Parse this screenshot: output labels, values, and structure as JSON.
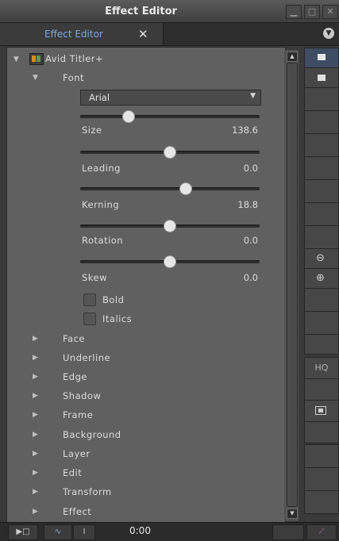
{
  "window": {
    "title": "Effect Editor"
  },
  "tab": {
    "label": "Effect Editor",
    "close": "✕",
    "menu_icon": "chevron-down-icon"
  },
  "tree": {
    "root": {
      "label": "Avid Titler+",
      "icon": "titler-icon"
    },
    "font": {
      "label": "Font",
      "family": "Arial",
      "params": [
        {
          "label": "Size",
          "value": "138.6",
          "slider": 0.27
        },
        {
          "label": "Leading",
          "value": "0.0",
          "slider": 0.5
        },
        {
          "label": "Kerning",
          "value": "18.8",
          "slider": 0.59
        },
        {
          "label": "Rotation",
          "value": "0.0",
          "slider": 0.5
        },
        {
          "label": "Skew",
          "value": "0.0",
          "slider": 0.5
        }
      ],
      "bold": "Bold",
      "italics": "Italics"
    },
    "sections": [
      "Face",
      "Underline",
      "Edge",
      "Shadow",
      "Frame",
      "Background",
      "Layer",
      "Edit",
      "Transform",
      "Effect"
    ]
  },
  "toolbar": {
    "hq": "HQ"
  },
  "bottom": {
    "timecode": "0:00"
  }
}
